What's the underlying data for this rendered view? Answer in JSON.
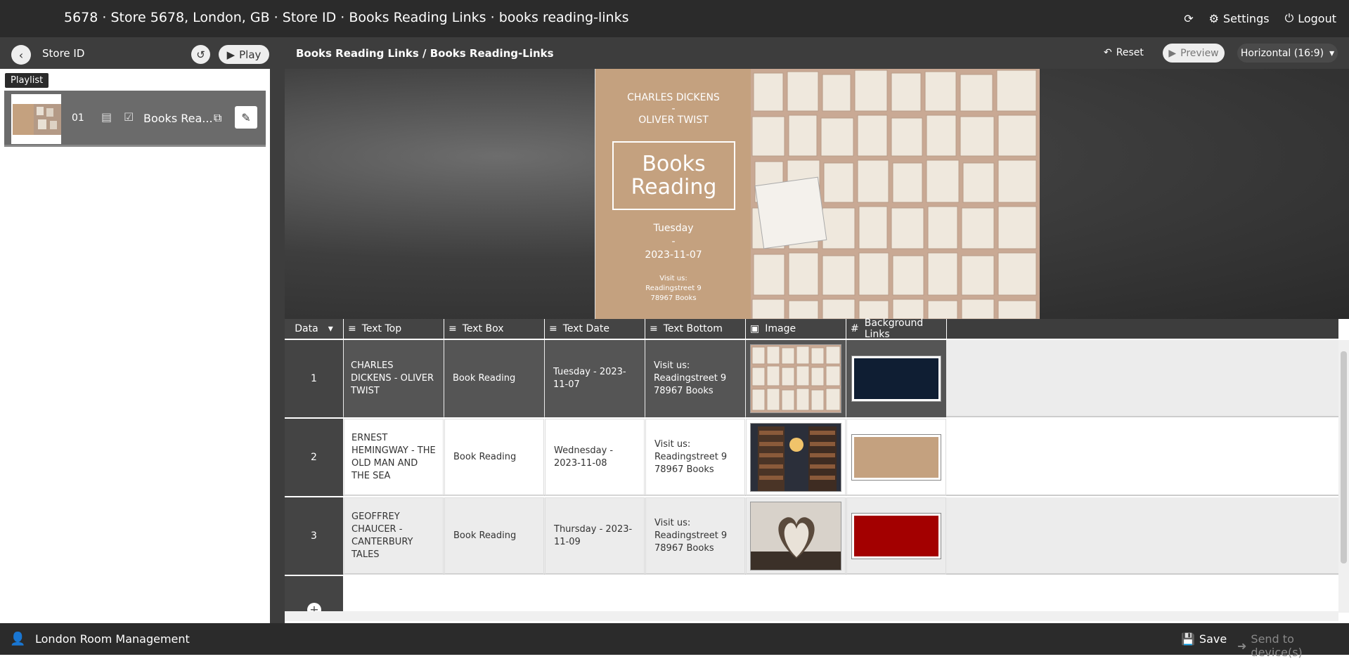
{
  "topbar": {
    "title": "5678 · Store 5678, London, GB · Store ID · Books Reading Links · books reading-links",
    "settings_label": "Settings",
    "logout_label": "Logout"
  },
  "subbar": {
    "store_label": "Store ID",
    "play_label": "Play",
    "breadcrumb": "Books Reading Links / Books Reading-Links",
    "reset_label": "Reset",
    "preview_label": "Preview",
    "orientation_label": "Horizontal (16:9)"
  },
  "playlist": {
    "tab_label": "Playlist",
    "item_number": "01",
    "item_name": "Books Rea..."
  },
  "slide": {
    "top_line1": "CHARLES DICKENS",
    "top_line2": "-",
    "top_line3": "OLIVER TWIST",
    "box_line1": "Books",
    "box_line2": "Reading",
    "date_line1": "Tuesday",
    "date_line2": "-",
    "date_line3": "2023-11-07",
    "bottom_line1": "Visit us:",
    "bottom_line2": "Readingstreet 9",
    "bottom_line3": "78967 Books"
  },
  "grid": {
    "data_header": "Data",
    "columns": [
      "Text Top",
      "Text Box",
      "Text Date",
      "Text Bottom",
      "Image",
      "Background Links"
    ],
    "rows": [
      {
        "num": "1",
        "text_top": "CHARLES DICKENS - OLIVER TWIST",
        "text_box": "Book Reading",
        "text_date": "Tuesday - 2023-11-07",
        "text_bottom_1": "Visit us:",
        "text_bottom_2": "Readingstreet 9",
        "text_bottom_3": "78967 Books",
        "bg_color": "#0f1e33"
      },
      {
        "num": "2",
        "text_top": "ERNEST HEMINGWAY - THE OLD MAN AND THE SEA",
        "text_box": "Book Reading",
        "text_date": "Wednesday - 2023-11-08",
        "text_bottom_1": "Visit us:",
        "text_bottom_2": "Readingstreet 9",
        "text_bottom_3": "78967 Books",
        "bg_color": "#c4a17f"
      },
      {
        "num": "3",
        "text_top": "GEOFFREY CHAUCER - CANTERBURY TALES",
        "text_box": "Book Reading",
        "text_date": "Thursday - 2023-11-09",
        "text_bottom_1": "Visit us:",
        "text_bottom_2": "Readingstreet 9",
        "text_bottom_3": "78967 Books",
        "bg_color": "#a30000"
      }
    ]
  },
  "bottom_bar": {
    "label": "London Room Management",
    "save_label": "Save",
    "send_label": "Send to device(s)"
  },
  "colors": {
    "accent_tan": "#c4a17f",
    "dark": "#2b2b2b"
  }
}
